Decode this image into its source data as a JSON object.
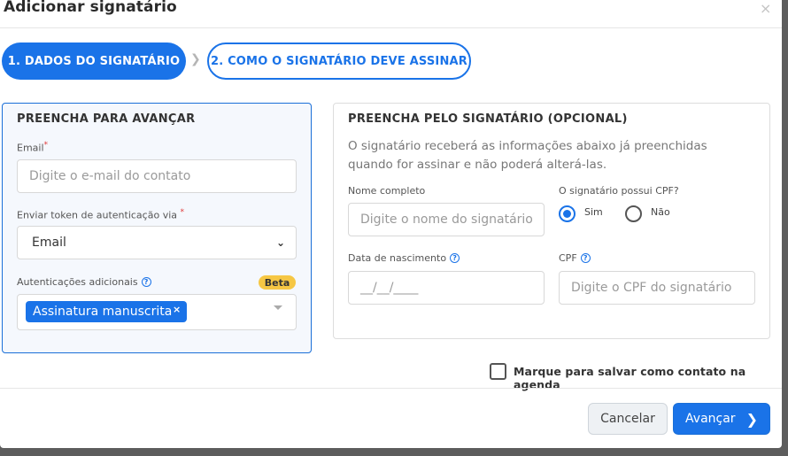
{
  "modal": {
    "title": "Adicionar signatário",
    "close_glyph": "×"
  },
  "steps": [
    {
      "label": "1. DADOS DO SIGNATÁRIO",
      "active": true
    },
    {
      "label": "2. COMO O SIGNATÁRIO DEVE ASSINAR",
      "active": false
    }
  ],
  "left_panel": {
    "title": "PREENCHA PARA AVANÇAR",
    "email_label": "Email",
    "required_mark": "*",
    "email_placeholder": "Digite o e-mail do contato",
    "token_label": "Enviar token de autenticação via ",
    "token_value": "Email",
    "auth_label": "Autenticações adicionais",
    "beta_badge": "Beta",
    "auth_tags": [
      "Assinatura manuscrita"
    ],
    "tag_remove_glyph": "×"
  },
  "right_panel": {
    "title": "PREENCHA PELO SIGNATÁRIO (OPCIONAL)",
    "description": "O signatário receberá as informações abaixo já preenchidas quando for assinar e não poderá alterá-las.",
    "name_label": "Nome completo",
    "name_placeholder": "Digite o nome do signatário",
    "cpf_question": "O signatário possui CPF?",
    "radio_yes": "Sim",
    "radio_no": "Não",
    "radio_selected": "Sim",
    "birth_label": "Data de nascimento",
    "birth_placeholder": "__/__/____",
    "cpf_label": "CPF",
    "cpf_placeholder": "Digite o CPF do signatário"
  },
  "save_contact": {
    "label": "Marque para salvar como contato na agenda",
    "checked": false
  },
  "footer": {
    "cancel_label": "Cancelar",
    "next_label": "Avançar"
  },
  "icons": {
    "help": "help-icon",
    "chevron_right": "chevron-right-icon",
    "chevron_down": "chevron-down-icon"
  },
  "colors": {
    "primary": "#1a73e8",
    "beta": "#f6c744",
    "required": "#e03b3b"
  }
}
